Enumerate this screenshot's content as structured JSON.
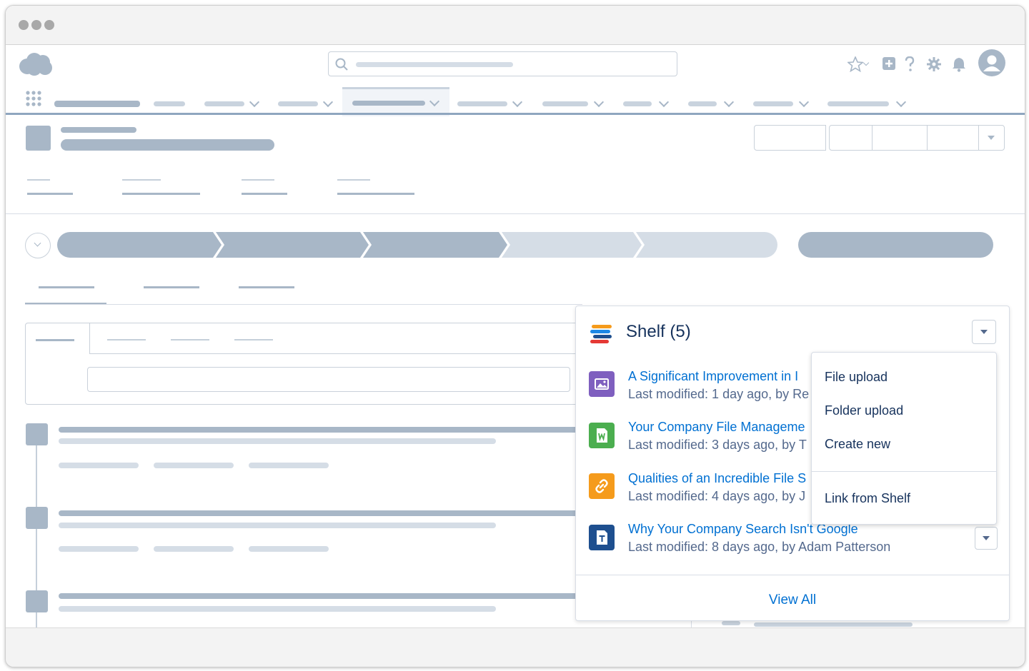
{
  "shelf": {
    "title": "Shelf (5)",
    "view_all": "View All",
    "files": [
      {
        "title": "A Significant Improvement in I",
        "meta": "Last modified: 1 day ago, by Re",
        "icon": "image-icon",
        "color": "#7f5fbf"
      },
      {
        "title": "Your Company File Manageme",
        "meta": "Last modified: 3 days ago, by T",
        "icon": "word-doc-icon",
        "color": "#4bae4f"
      },
      {
        "title": "Qualities of an Incredible File S",
        "meta": "Last modified: 4 days ago, by J",
        "icon": "link-icon",
        "color": "#f59b1c"
      },
      {
        "title": "Why Your Company Search Isn't Google",
        "meta": "Last modified: 8 days ago, by Adam Patterson",
        "icon": "text-doc-icon",
        "color": "#1e4f8f"
      }
    ]
  },
  "menu": {
    "items": [
      "File upload",
      "Folder upload",
      "Create new",
      "Link from Shelf"
    ]
  },
  "colors": {
    "link": "#0070d2",
    "text": "#16325c",
    "placeholder": "#a8b7c7",
    "nav_accent": "#8fa6bf"
  }
}
